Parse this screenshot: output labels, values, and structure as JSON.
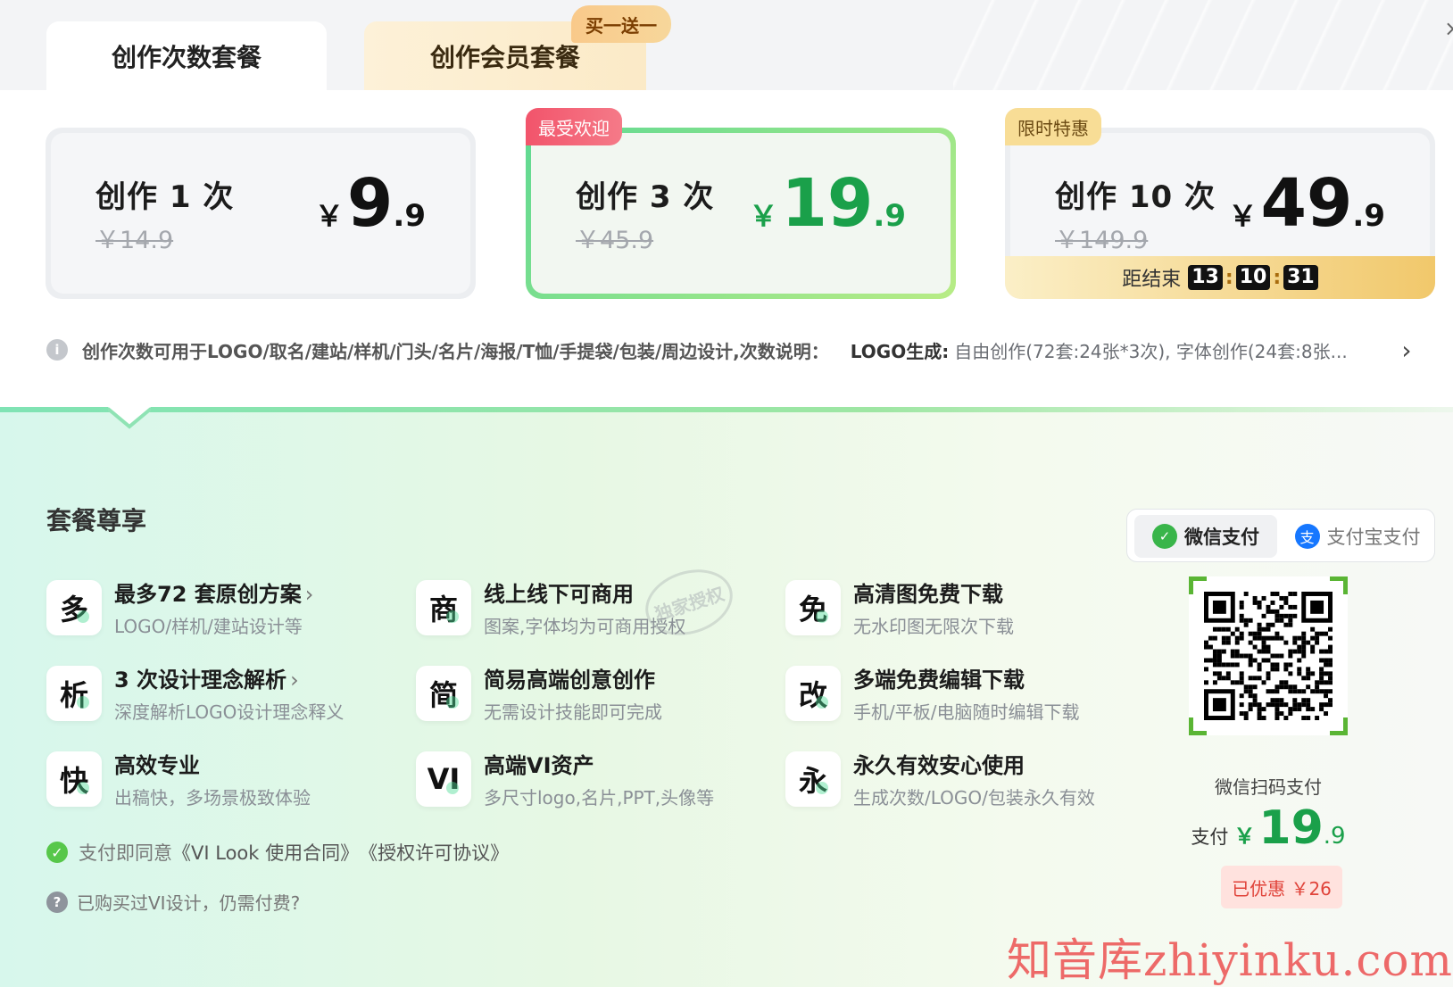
{
  "tabs": [
    {
      "label": "创作次数套餐"
    },
    {
      "label": "创作会员套餐",
      "badge": "买一送一"
    }
  ],
  "plans": [
    {
      "title": "创作 1 次",
      "original_price": "￥14.9",
      "currency": "￥",
      "price_int": "9",
      "price_dec": ".9"
    },
    {
      "title": "创作 3 次",
      "original_price": "￥45.9",
      "currency": "￥",
      "price_int": "19",
      "price_dec": ".9",
      "badge": "最受欢迎"
    },
    {
      "title": "创作 10 次",
      "original_price": "￥149.9",
      "currency": "￥",
      "price_int": "49",
      "price_dec": ".9",
      "badge": "限时特惠",
      "countdown": {
        "label": "距结束",
        "hours": "13",
        "minutes": "10",
        "seconds": "31"
      }
    }
  ],
  "info": {
    "icon": "info-icon",
    "text": "创作次数可用于LOGO/取名/建站/样机/门头/名片/海报/T恤/手提袋/包装/周边设计,次数说明：",
    "key": "LOGO生成:",
    "detail": "自由创作(72套:24张*3次), 字体创作(24套:8张..."
  },
  "benefits": {
    "title": "套餐尊享",
    "items": [
      {
        "icon_char": "多",
        "title": "最多72 套原创方案",
        "has_arrow": true,
        "arrow": "›",
        "desc": "LOGO/样机/建站设计等"
      },
      {
        "icon_char": "商",
        "title": "线上线下可商用",
        "desc": "图案,字体均为可商用授权"
      },
      {
        "icon_char": "免",
        "title": "高清图免费下载",
        "desc": "无水印图无限次下载"
      },
      {
        "icon_char": "析",
        "title": "3 次设计理念解析",
        "has_arrow": true,
        "arrow": "›",
        "desc": "深度解析LOGO设计理念释义"
      },
      {
        "icon_char": "简",
        "title": "简易高端创意创作",
        "desc": "无需设计技能即可完成"
      },
      {
        "icon_char": "改",
        "title": "多端免费编辑下载",
        "desc": "手机/平板/电脑随时编辑下载"
      },
      {
        "icon_char": "快",
        "title": "高效专业",
        "desc": "出稿快，多场景极致体验"
      },
      {
        "icon_char": "VI",
        "title": "高端VI资产",
        "desc": "多尺寸logo,名片,PPT,头像等"
      },
      {
        "icon_char": "永",
        "title": "永久有效安心使用",
        "desc": "生成次数/LOGO/包装永久有效"
      }
    ],
    "stamp": "独家授权"
  },
  "agreement": {
    "prefix": "支付即同意",
    "contract1": "《VI Look 使用合同》",
    "contract2": "《授权许可协议》"
  },
  "question": {
    "text": "已购买过VI设计，仍需付费?"
  },
  "payment": {
    "methods": [
      {
        "label": "微信支付",
        "icon": "wechat-icon",
        "active": true
      },
      {
        "label": "支付宝支付",
        "icon": "alipay-icon",
        "active": false
      }
    ],
    "qr_caption": "微信扫码支付",
    "amount_label": "支付",
    "currency": "￥",
    "amount_int": "19",
    "amount_dec": ".9",
    "discount": "已优惠 ￥26"
  },
  "watermark": "知音库zhiyinku.com",
  "colors": {
    "accent_green": "#1aa04a",
    "badge_red": "#f2546b",
    "badge_gold": "#f8dd96",
    "discount_red": "#e0433a"
  }
}
